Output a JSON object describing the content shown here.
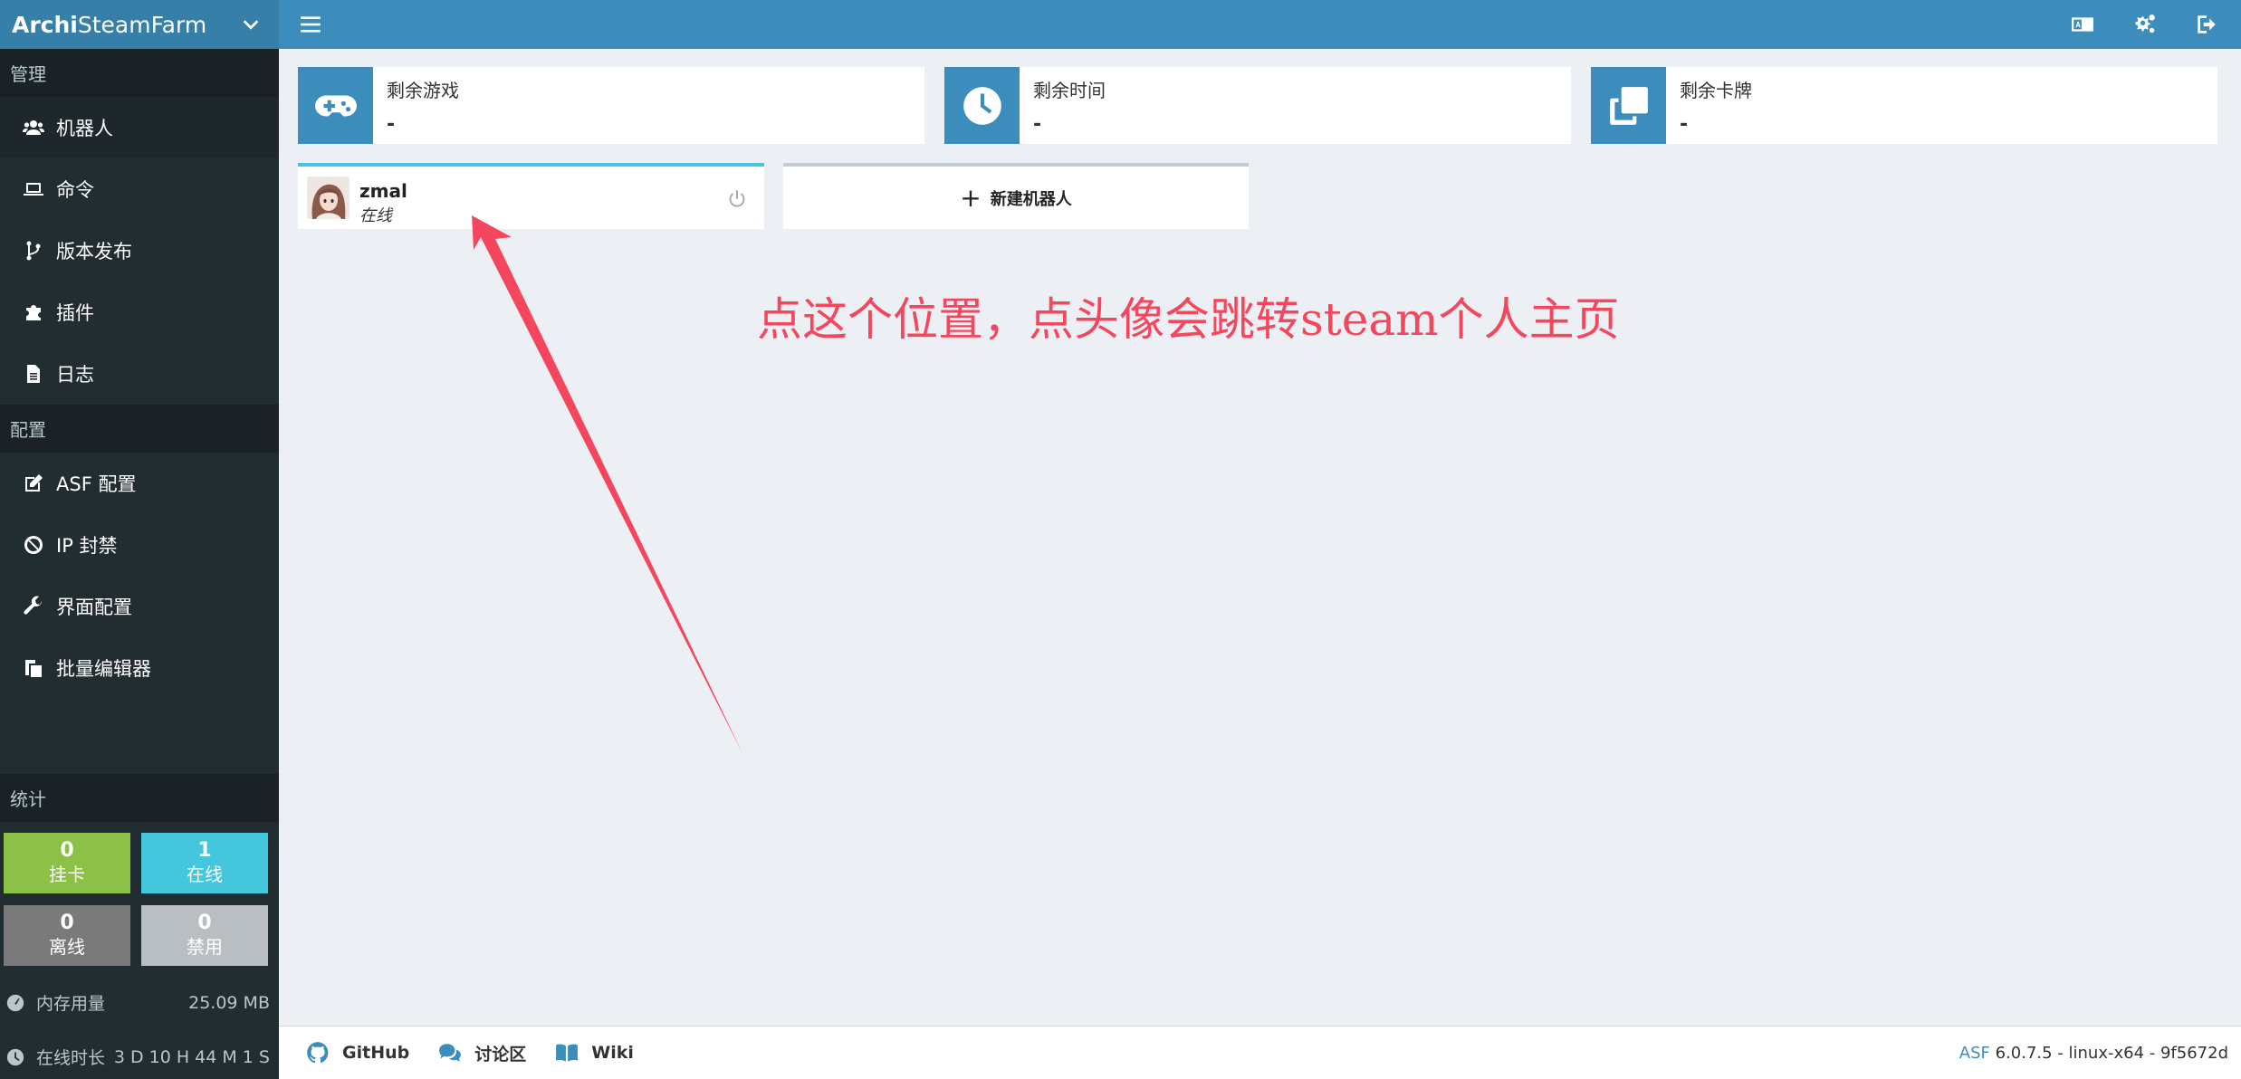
{
  "brand": {
    "prefix": "Archi",
    "rest": "SteamFarm"
  },
  "sidebar": {
    "manage_header": "管理",
    "manage_items": [
      {
        "label": "机器人",
        "icon": "users-icon"
      },
      {
        "label": "命令",
        "icon": "laptop-icon"
      },
      {
        "label": "版本发布",
        "icon": "code-branch-icon"
      },
      {
        "label": "插件",
        "icon": "puzzle-icon"
      },
      {
        "label": "日志",
        "icon": "file-icon"
      }
    ],
    "config_header": "配置",
    "config_items": [
      {
        "label": "ASF 配置",
        "icon": "edit-icon"
      },
      {
        "label": "IP 封禁",
        "icon": "ban-icon"
      },
      {
        "label": "界面配置",
        "icon": "wrench-icon"
      },
      {
        "label": "批量编辑器",
        "icon": "copy-icon"
      }
    ],
    "stats_header": "统计",
    "stats": {
      "farming": {
        "count": "0",
        "label": "挂卡",
        "color": "#8dc047"
      },
      "online": {
        "count": "1",
        "label": "在线",
        "color": "#44c6dc"
      },
      "offline": {
        "count": "0",
        "label": "离线",
        "color": "#7a7a7a"
      },
      "disabled": {
        "count": "0",
        "label": "禁用",
        "color": "#b9bec3"
      }
    },
    "memory": {
      "label": "内存用量",
      "value": "25.09 MB"
    },
    "uptime": {
      "label": "在线时长",
      "value": "3 D 10 H 44 M 1 S"
    }
  },
  "info_boxes": [
    {
      "title": "剩余游戏",
      "value": "-",
      "icon": "gamepad-icon"
    },
    {
      "title": "剩余时间",
      "value": "-",
      "icon": "clock-icon"
    },
    {
      "title": "剩余卡牌",
      "value": "-",
      "icon": "clone-icon"
    }
  ],
  "bot": {
    "name": "zmal",
    "status": "在线"
  },
  "new_bot": {
    "label": "新建机器人"
  },
  "annotation": "点这个位置，点头像会跳转steam个人主页",
  "footer": {
    "links": [
      "GitHub",
      "讨论区",
      "Wiki"
    ],
    "asf": "ASF",
    "version": " 6.0.7.5 - linux-x64 - 9f5672d"
  },
  "colors": {
    "primary": "#3c8dbc",
    "sidebar": "#222d32",
    "annotation": "#f4465c"
  }
}
